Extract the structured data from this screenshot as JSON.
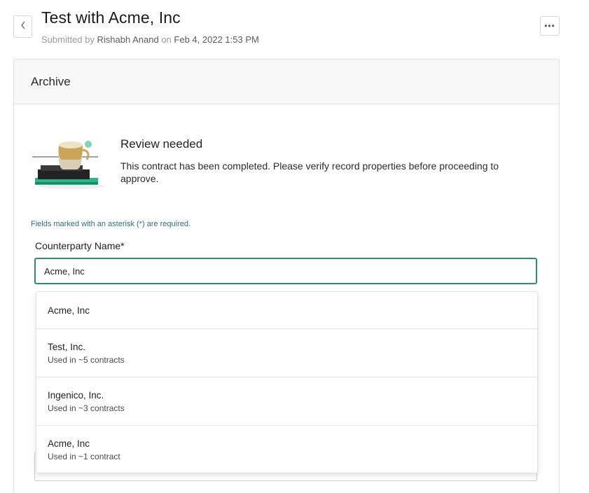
{
  "header": {
    "title": "Test with Acme, Inc",
    "submitted_prefix": "Submitted by",
    "submitter": "Rishabh Anand",
    "on_word": "on",
    "submitted_date": "Feb 4, 2022 1:53 PM",
    "back_icon": "chevron-left-icon",
    "more_icon": "ellipsis-icon",
    "more_label": "•••"
  },
  "card": {
    "title": "Archive",
    "review": {
      "title": "Review needed",
      "body": "This contract has been completed. Please verify record properties before proceeding to approve."
    },
    "form": {
      "required_note": "Fields marked with an asterisk (*) are required.",
      "counterparty_label": "Counterparty Name*",
      "counterparty_value": "Acme, Inc"
    }
  },
  "dropdown": {
    "options": [
      {
        "name": "Acme, Inc",
        "meta": ""
      },
      {
        "name": "Test, Inc.",
        "meta": "Used in ~5 contracts"
      },
      {
        "name": "Ingenico, Inc.",
        "meta": "Used in ~3 contracts"
      },
      {
        "name": "Acme, Inc",
        "meta": "Used in ~1 contract"
      }
    ]
  },
  "colors": {
    "accent": "#2a8f70",
    "note": "#2f6f82"
  }
}
